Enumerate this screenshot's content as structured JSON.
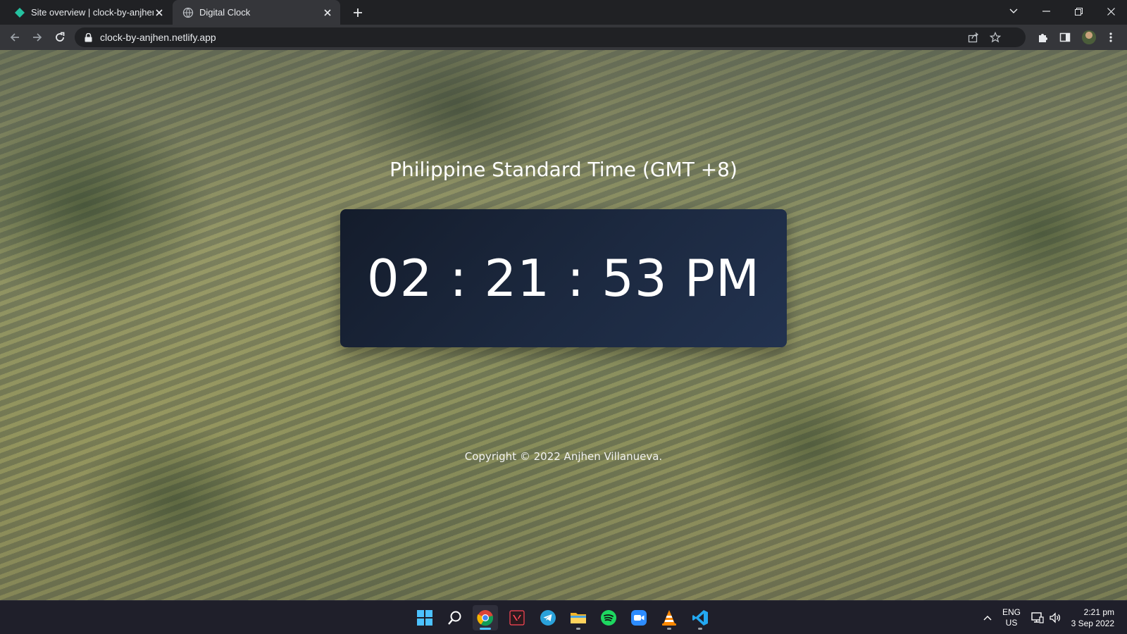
{
  "browser": {
    "tabs": [
      {
        "title": "Site overview | clock-by-anjhen",
        "active": false,
        "favicon": "netlify-diamond-icon"
      },
      {
        "title": "Digital Clock",
        "active": true,
        "favicon": "globe-icon"
      }
    ],
    "url": "clock-by-anjhen.netlify.app"
  },
  "page": {
    "heading": "Philippine Standard Time (GMT +8)",
    "time": "02 : 21 : 53 PM",
    "copyright": "Copyright © 2022 Anjhen Villanueva."
  },
  "taskbar": {
    "apps": [
      "windows-start-icon",
      "search-icon",
      "chrome-icon",
      "valorant-icon",
      "telegram-icon",
      "file-explorer-icon",
      "spotify-icon",
      "zoom-icon",
      "vlc-icon",
      "vscode-icon"
    ],
    "language": {
      "line1": "ENG",
      "line2": "US"
    },
    "time": "2:21 pm",
    "date": "3 Sep 2022"
  },
  "colors": {
    "card": "#1c2940",
    "accent": "#4cc2ff",
    "tab_active": "#35363a",
    "chrome_bg": "#202124"
  }
}
